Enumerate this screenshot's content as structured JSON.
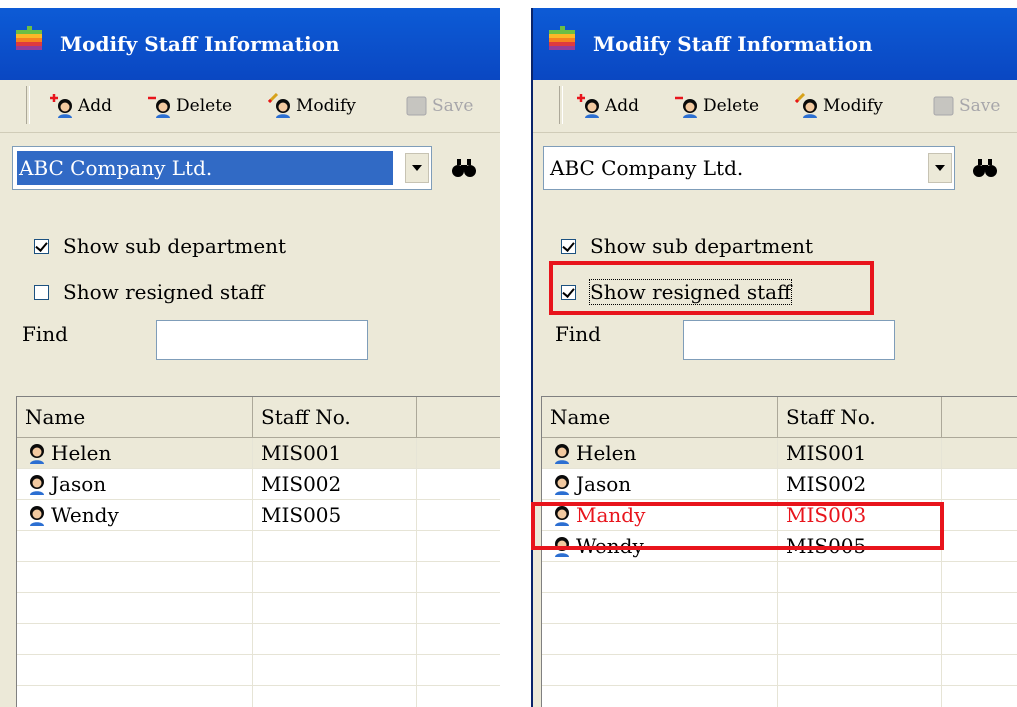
{
  "windows": [
    {
      "title": "Modify Staff Information",
      "toolbar": {
        "add": "Add",
        "delete": "Delete",
        "modify": "Modify",
        "save": "Save"
      },
      "company": "ABC Company Ltd.",
      "options": {
        "show_sub_department": "Show sub department",
        "show_resigned_staff": "Show resigned staff",
        "sub_checked": true,
        "resigned_checked": false
      },
      "find_label": "Find",
      "find_value": "",
      "columns": [
        "Name",
        "Staff No."
      ],
      "rows": [
        {
          "name": "Helen",
          "staff_no": "MIS001",
          "selected": true,
          "resigned": false
        },
        {
          "name": "Jason",
          "staff_no": "MIS002",
          "selected": false,
          "resigned": false
        },
        {
          "name": "Wendy",
          "staff_no": "MIS005",
          "selected": false,
          "resigned": false
        }
      ]
    },
    {
      "title": "Modify Staff Information",
      "toolbar": {
        "add": "Add",
        "delete": "Delete",
        "modify": "Modify",
        "save": "Save"
      },
      "company": "ABC Company Ltd.",
      "options": {
        "show_sub_department": "Show sub department",
        "show_resigned_staff": "Show resigned staff",
        "sub_checked": true,
        "resigned_checked": true
      },
      "find_label": "Find",
      "find_value": "",
      "columns": [
        "Name",
        "Staff No."
      ],
      "rows": [
        {
          "name": "Helen",
          "staff_no": "MIS001",
          "selected": true,
          "resigned": false
        },
        {
          "name": "Jason",
          "staff_no": "MIS002",
          "selected": false,
          "resigned": false
        },
        {
          "name": "Mandy",
          "staff_no": "MIS003",
          "selected": false,
          "resigned": true
        },
        {
          "name": "Wendy",
          "staff_no": "MIS005",
          "selected": false,
          "resigned": false
        }
      ]
    }
  ],
  "colors": {
    "title_bar": "#0a47c2",
    "highlight": "#e8141c",
    "selection": "#316ac5",
    "resigned_text": "#e8141c"
  },
  "icons": {
    "title": "apple-logo-icon",
    "add": "add-person-icon",
    "delete": "delete-person-icon",
    "modify": "modify-person-icon",
    "save": "save-icon",
    "find": "binoculars-icon",
    "row": "person-icon"
  }
}
